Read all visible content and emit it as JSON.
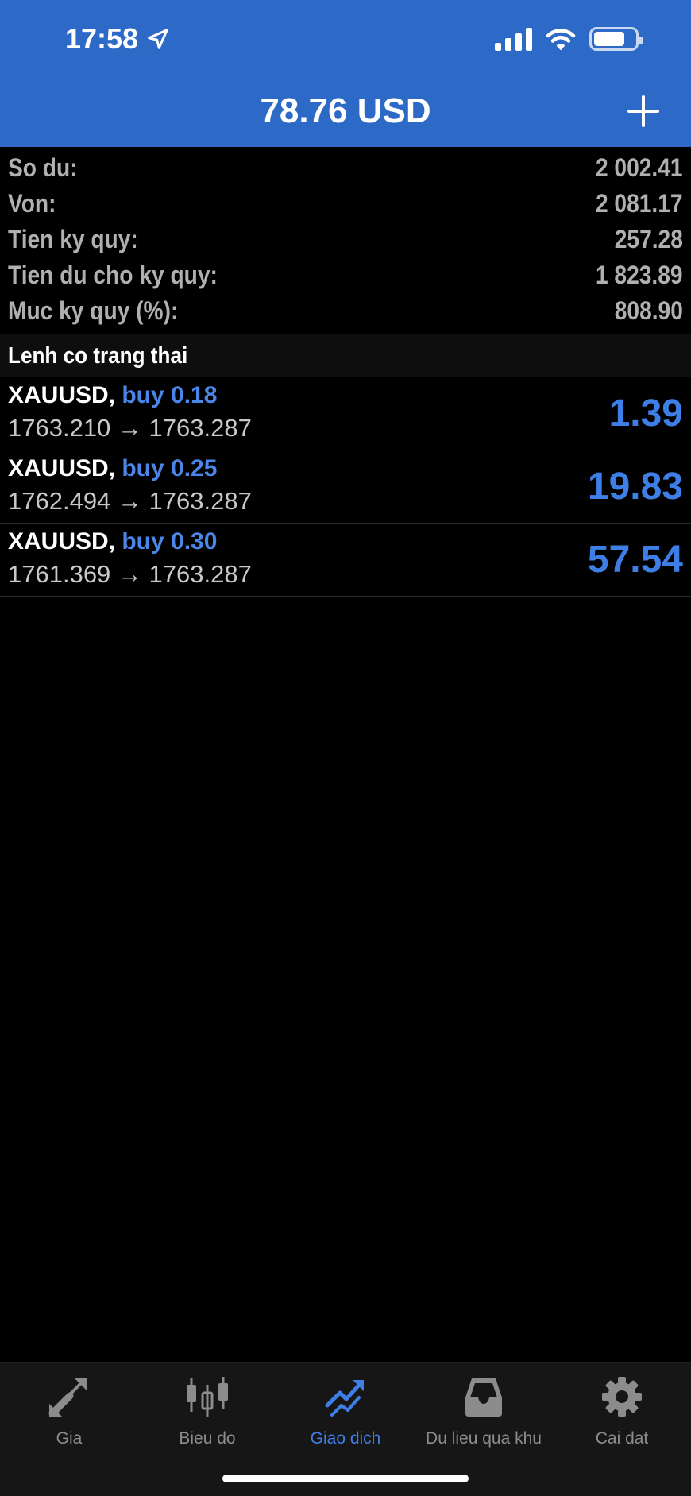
{
  "status": {
    "time": "17:58"
  },
  "header": {
    "title": "78.76 USD"
  },
  "summary": [
    {
      "label": "So du:",
      "value": "2 002.41"
    },
    {
      "label": "Von:",
      "value": "2 081.17"
    },
    {
      "label": "Tien ky quy:",
      "value": "257.28"
    },
    {
      "label": "Tien du cho ky quy:",
      "value": "1 823.89"
    },
    {
      "label": "Muc ky quy (%):",
      "value": "808.90"
    }
  ],
  "section": {
    "title": "Lenh co trang thai"
  },
  "orders": [
    {
      "symbol": "XAUUSD,",
      "side": "buy 0.18",
      "prices": "1763.210 → 1763.287",
      "profit": "1.39"
    },
    {
      "symbol": "XAUUSD,",
      "side": "buy 0.25",
      "prices": "1762.494 → 1763.287",
      "profit": "19.83"
    },
    {
      "symbol": "XAUUSD,",
      "side": "buy 0.30",
      "prices": "1761.369 → 1763.287",
      "profit": "57.54"
    }
  ],
  "tabs": [
    {
      "label": "Gia",
      "icon": "quotes-arrows-icon",
      "active": false
    },
    {
      "label": "Bieu do",
      "icon": "candlestick-chart-icon",
      "active": false
    },
    {
      "label": "Giao dich",
      "icon": "trade-chart-icon",
      "active": true
    },
    {
      "label": "Du lieu qua khu",
      "icon": "history-tray-icon",
      "active": false
    },
    {
      "label": "Cai dat",
      "icon": "gear-icon",
      "active": false
    }
  ],
  "colors": {
    "header_bg": "#2d6ac7",
    "accent": "#3d7fe6",
    "background": "#000000"
  }
}
